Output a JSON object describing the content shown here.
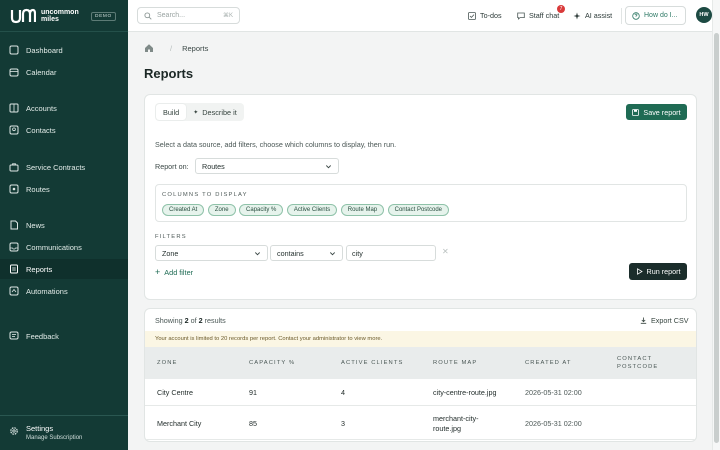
{
  "app": {
    "logo_text_line1": "uncommon",
    "logo_text_line2": "miles",
    "badge": "DEMO"
  },
  "sidebar": {
    "items": [
      {
        "label": "Dashboard",
        "icon": "grid-icon"
      },
      {
        "label": "Calendar",
        "icon": "calendar-icon"
      },
      {
        "label": "Accounts",
        "icon": "building-icon"
      },
      {
        "label": "Contacts",
        "icon": "contact-card-icon"
      },
      {
        "label": "Service Contracts",
        "icon": "briefcase-icon"
      },
      {
        "label": "Routes",
        "icon": "route-icon"
      },
      {
        "label": "News",
        "icon": "document-icon"
      },
      {
        "label": "Communications",
        "icon": "inbox-icon"
      },
      {
        "label": "Reports",
        "icon": "report-icon",
        "active": true
      },
      {
        "label": "Automations",
        "icon": "automation-icon"
      },
      {
        "label": "Feedback",
        "icon": "feedback-icon"
      }
    ],
    "settings_label": "Settings",
    "settings_sub": "Manage Subscription"
  },
  "topbar": {
    "search_placeholder": "Search...",
    "search_shortcut": "⌘K",
    "todos": "To-dos",
    "staff_chat": "Staff chat",
    "staff_chat_badge": "7",
    "ai_assist": "AI assist",
    "how_do_i": "How do I...",
    "avatar_initials": "HW"
  },
  "breadcrumb": {
    "current": "Reports"
  },
  "page_title": "Reports",
  "builder": {
    "tab_build": "Build",
    "tab_describe": "Describe it",
    "save_label": "Save report",
    "description": "Select a data source, add filters, choose which columns to display, then run.",
    "report_on_label": "Report on:",
    "report_on_value": "Routes",
    "columns_label": "COLUMNS TO DISPLAY",
    "columns": [
      "Created At",
      "Zone",
      "Capacity %",
      "Active Clients",
      "Route Map",
      "Contact Postcode"
    ],
    "filters_label": "FILTERS",
    "filter": {
      "field": "Zone",
      "operator": "contains",
      "value": "city"
    },
    "add_filter": "Add filter",
    "run_label": "Run report"
  },
  "results": {
    "showing_prefix": "Showing",
    "shown": "2",
    "of": "of",
    "total": "2",
    "suffix": "results",
    "export_label": "Export CSV",
    "notice": "Your account is limited to 20 records per report. Contact your administrator to view more.",
    "headers": [
      "ZONE",
      "CAPACITY %",
      "ACTIVE CLIENTS",
      "ROUTE MAP",
      "CREATED AT",
      "CONTACT POSTCODE"
    ],
    "rows": [
      {
        "zone": "City Centre",
        "capacity": "91",
        "active_clients": "4",
        "route_map": "city-centre-route.jpg",
        "created_at": "2026-05-31 02:00",
        "postcode": ""
      },
      {
        "zone": "Merchant City",
        "capacity": "85",
        "active_clients": "3",
        "route_map": "merchant-city-route.jpg",
        "created_at": "2026-05-31 02:00",
        "postcode": ""
      }
    ]
  },
  "colors": {
    "sidebar_bg": "#133a35",
    "accent_green": "#1f6b54",
    "run_button": "#1b2d2b",
    "notice_bg": "#fbf6e4"
  }
}
